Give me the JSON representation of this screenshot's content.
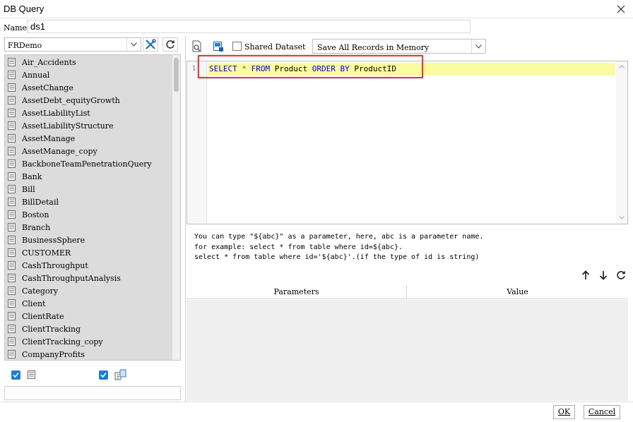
{
  "window": {
    "title": "DB Query"
  },
  "name_field": {
    "label": "Name:",
    "value": "ds1"
  },
  "datasource": {
    "selected": "FRDemo",
    "tables": [
      "Air_Accidents",
      "Annual",
      "AssetChange",
      "AssetDebt_equityGrowth",
      "AssetLiabilityList",
      "AssetLiabilityStructure",
      "AssetManage",
      "AssetManage_copy",
      "BackboneTeamPenetrationQuery",
      "Bank",
      "Bill",
      "BillDetail",
      "Boston",
      "Branch",
      "BusinessSphere",
      "CUSTOMER",
      "CashThroughput",
      "CashThroughputAnalysis",
      "Category",
      "Client",
      "ClientRate",
      "ClientTracking",
      "ClientTracking_copy",
      "CompanyProfits"
    ]
  },
  "toolbar": {
    "shared_dataset_label": "Shared Dataset",
    "memory_option": "Save All Records in Memory"
  },
  "editor": {
    "line_number": "1",
    "tokens": [
      {
        "text": "SELECT",
        "cls": "kw"
      },
      {
        "text": " ",
        "cls": "ident"
      },
      {
        "text": "*",
        "cls": "op"
      },
      {
        "text": " ",
        "cls": "ident"
      },
      {
        "text": "FROM",
        "cls": "kw"
      },
      {
        "text": " Product ",
        "cls": "ident"
      },
      {
        "text": "ORDER BY",
        "cls": "kw"
      },
      {
        "text": " ProductID",
        "cls": "ident"
      }
    ]
  },
  "hint": {
    "line1": "You can type \"${abc}\" as a parameter, here, abc is a parameter name.",
    "line2": "for example: select * from table where id=${abc}.",
    "line3": "select * from table where id='${abc}'.(if the type of id is string)"
  },
  "params_table": {
    "col_parameters": "Parameters",
    "col_value": "Value"
  },
  "footer": {
    "ok_label": "OK",
    "cancel_label": "Cancel"
  }
}
